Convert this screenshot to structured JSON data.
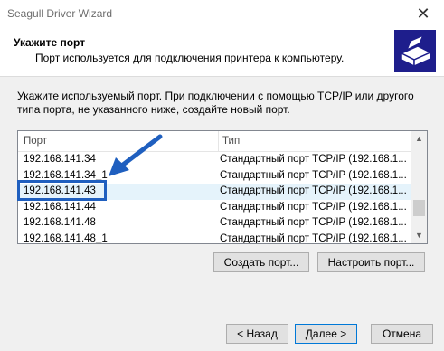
{
  "window": {
    "title": "Seagull Driver Wizard",
    "close_glyph": "✕"
  },
  "header": {
    "title": "Укажите порт",
    "subtitle": "Порт используется для подключения принтера к компьютеру.",
    "icon": "printer-icon"
  },
  "description": "Укажите используемый порт. При подключении с помощью TCP/IP или другого типа порта, не указанного ниже, создайте новый порт.",
  "ports_table": {
    "columns": [
      "Порт",
      "Тип"
    ],
    "rows": [
      {
        "port": "192.168.141.34",
        "type": "Стандартный порт TCP/IP (192.168.1..."
      },
      {
        "port": "192.168.141.34_1",
        "type": "Стандартный порт TCP/IP (192.168.1..."
      },
      {
        "port": "192.168.141.43",
        "type": "Стандартный порт TCP/IP (192.168.1...",
        "selected": true
      },
      {
        "port": "192.168.141.44",
        "type": "Стандартный порт TCP/IP (192.168.1..."
      },
      {
        "port": "192.168.141.48",
        "type": "Стандартный порт TCP/IP (192.168.1..."
      },
      {
        "port": "192.168.141.48_1",
        "type": "Стандартный порт TCP/IP (192.168.1..."
      }
    ]
  },
  "buttons": {
    "create_port": "Создать порт...",
    "configure_port": "Настроить порт...",
    "back": "< Назад",
    "next": "Далее >",
    "cancel": "Отмена"
  },
  "annotation": {
    "arrow_color": "#1f5fbf",
    "highlight_color": "#1f5fbf"
  }
}
